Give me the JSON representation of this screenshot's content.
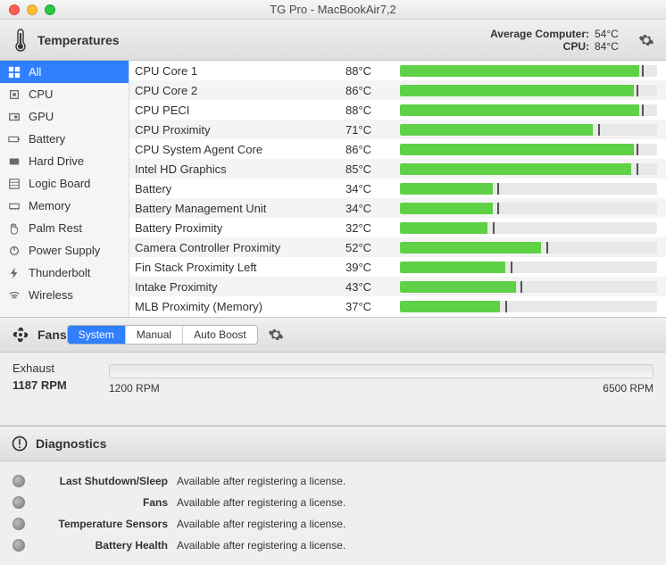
{
  "window": {
    "title": "TG Pro - MacBookAir7,2"
  },
  "temperatures": {
    "header_label": "Temperatures",
    "avg_computer_label": "Average Computer:",
    "avg_computer_value": "54°C",
    "cpu_label": "CPU:",
    "cpu_value": "84°C"
  },
  "sidebar": {
    "items": [
      {
        "label": "All",
        "icon": "grid-icon",
        "selected": true
      },
      {
        "label": "CPU",
        "icon": "chip-icon",
        "selected": false
      },
      {
        "label": "GPU",
        "icon": "gpu-icon",
        "selected": false
      },
      {
        "label": "Battery",
        "icon": "battery-icon",
        "selected": false
      },
      {
        "label": "Hard Drive",
        "icon": "drive-icon",
        "selected": false
      },
      {
        "label": "Logic Board",
        "icon": "board-icon",
        "selected": false
      },
      {
        "label": "Memory",
        "icon": "memory-icon",
        "selected": false
      },
      {
        "label": "Palm Rest",
        "icon": "hand-icon",
        "selected": false
      },
      {
        "label": "Power Supply",
        "icon": "power-icon",
        "selected": false
      },
      {
        "label": "Thunderbolt",
        "icon": "bolt-icon",
        "selected": false
      },
      {
        "label": "Wireless",
        "icon": "wifi-icon",
        "selected": false
      }
    ]
  },
  "sensors": [
    {
      "name": "CPU Core 1",
      "temp": "88°C",
      "fill": 93,
      "tick": 94
    },
    {
      "name": "CPU Core 2",
      "temp": "86°C",
      "fill": 91,
      "tick": 92
    },
    {
      "name": "CPU PECI",
      "temp": "88°C",
      "fill": 93,
      "tick": 94
    },
    {
      "name": "CPU Proximity",
      "temp": "71°C",
      "fill": 75,
      "tick": 77
    },
    {
      "name": "CPU System Agent Core",
      "temp": "86°C",
      "fill": 91,
      "tick": 92
    },
    {
      "name": "Intel HD Graphics",
      "temp": "85°C",
      "fill": 90,
      "tick": 92
    },
    {
      "name": "Battery",
      "temp": "34°C",
      "fill": 36,
      "tick": 38
    },
    {
      "name": "Battery Management Unit",
      "temp": "34°C",
      "fill": 36,
      "tick": 38
    },
    {
      "name": "Battery Proximity",
      "temp": "32°C",
      "fill": 34,
      "tick": 36
    },
    {
      "name": "Camera Controller Proximity",
      "temp": "52°C",
      "fill": 55,
      "tick": 57
    },
    {
      "name": "Fin Stack Proximity Left",
      "temp": "39°C",
      "fill": 41,
      "tick": 43
    },
    {
      "name": "Intake Proximity",
      "temp": "43°C",
      "fill": 45,
      "tick": 47
    },
    {
      "name": "MLB Proximity (Memory)",
      "temp": "37°C",
      "fill": 39,
      "tick": 41
    }
  ],
  "fans": {
    "header_label": "Fans",
    "modes": [
      {
        "label": "System",
        "active": true
      },
      {
        "label": "Manual",
        "active": false
      },
      {
        "label": "Auto Boost",
        "active": false
      }
    ],
    "fan": {
      "name": "Exhaust",
      "rpm": "1187 RPM",
      "min": "1200 RPM",
      "max": "6500 RPM"
    }
  },
  "diagnostics": {
    "header_label": "Diagnostics",
    "rows": [
      {
        "label": "Last Shutdown/Sleep",
        "value": "Available after registering a license."
      },
      {
        "label": "Fans",
        "value": "Available after registering a license."
      },
      {
        "label": "Temperature Sensors",
        "value": "Available after registering a license."
      },
      {
        "label": "Battery Health",
        "value": "Available after registering a license."
      }
    ]
  }
}
